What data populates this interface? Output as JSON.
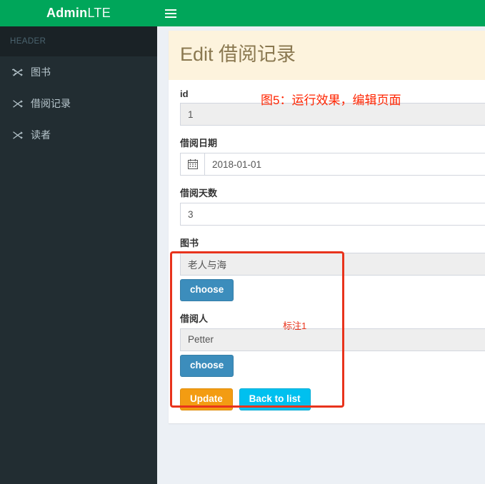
{
  "navbar": {
    "logo_bold": "Admin",
    "logo_light": "LTE",
    "toggle_icon": "hamburger-icon"
  },
  "sidebar": {
    "header": "HEADER",
    "items": [
      {
        "label": "图书",
        "icon": "shuffle-icon"
      },
      {
        "label": "借阅记录",
        "icon": "shuffle-icon"
      },
      {
        "label": "读者",
        "icon": "shuffle-icon"
      }
    ]
  },
  "panel": {
    "title": "Edit 借阅记录",
    "fields": [
      {
        "label": "id",
        "value": "1",
        "disabled": true
      },
      {
        "label": "借阅日期",
        "value": "2018-01-01",
        "addon_icon": "calendar-icon"
      },
      {
        "label": "借阅天数",
        "value": "3"
      },
      {
        "label": "图书",
        "value": "老人与海",
        "disabled": true,
        "choose_label": "choose"
      },
      {
        "label": "借阅人",
        "value": "Petter",
        "disabled": true,
        "choose_label": "choose"
      }
    ],
    "actions": {
      "update_label": "Update",
      "back_label": "Back to list"
    }
  },
  "annotations": {
    "title": "图5：运行效果，编辑页面",
    "box_label": "标注1",
    "color": "#e8331c"
  },
  "colors": {
    "navbar": "#00a65a",
    "sidebar": "#222d32",
    "body_bg": "#ecf0f5",
    "panel_head": "#fdf3dd",
    "panel_title": "#8a7850",
    "primary": "#3c8dbc",
    "warning": "#f39c12",
    "info": "#00c0ef"
  }
}
